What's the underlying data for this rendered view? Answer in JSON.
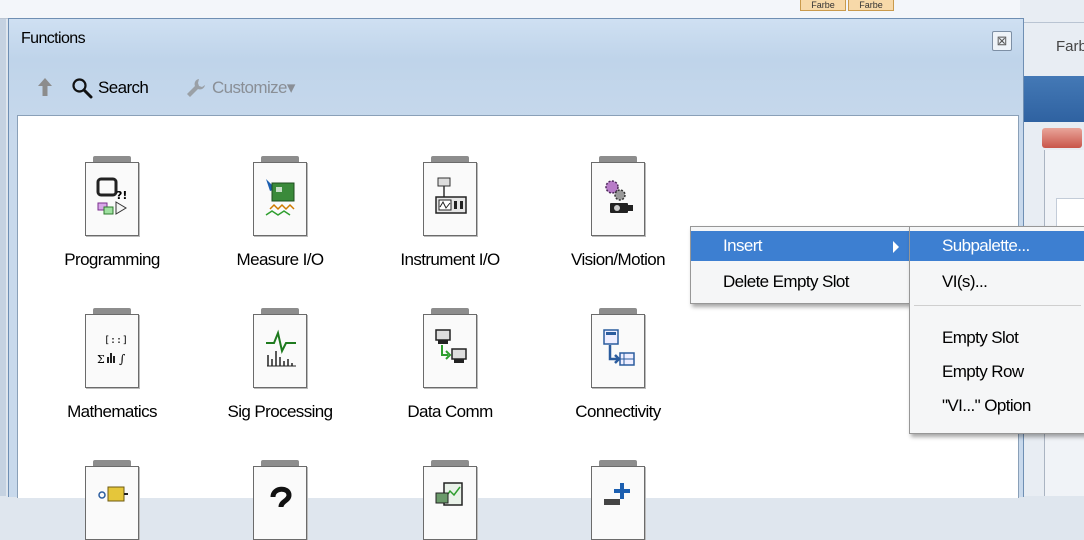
{
  "window": {
    "title": "Functions",
    "close_glyph": "⊠"
  },
  "toolbar": {
    "up_icon": "up-arrow-icon",
    "search_label": "Search",
    "customize_label": "Customize▾"
  },
  "background": {
    "chip1": "Farbe",
    "chip2": "Farbe",
    "side_label": "Farb"
  },
  "palette": {
    "items": [
      {
        "label": "Programming",
        "icon": "programming-icon"
      },
      {
        "label": "Measure I/O",
        "icon": "measure-io-icon"
      },
      {
        "label": "Instrument I/O",
        "icon": "instrument-io-icon"
      },
      {
        "label": "Vision/Motion",
        "icon": "vision-motion-icon"
      },
      {
        "label": "Mathematics",
        "icon": "mathematics-icon"
      },
      {
        "label": "Sig Processing",
        "icon": "sig-processing-icon"
      },
      {
        "label": "Data Comm",
        "icon": "data-comm-icon"
      },
      {
        "label": "Connectivity",
        "icon": "connectivity-icon"
      }
    ]
  },
  "context_menu": {
    "items": [
      {
        "label": "Insert",
        "highlighted": true,
        "has_submenu": true
      },
      {
        "label": "Delete Empty Slot",
        "highlighted": false
      }
    ]
  },
  "submenu": {
    "items": [
      {
        "label": "Subpalette...",
        "highlighted": true
      },
      {
        "label": "VI(s)..."
      },
      {
        "label": "Empty Slot"
      },
      {
        "label": "Empty Row"
      },
      {
        "label": "\"VI...\" Option"
      }
    ]
  },
  "colors": {
    "highlight": "#3d7fd1",
    "window_frame": "#bfd4ea"
  }
}
